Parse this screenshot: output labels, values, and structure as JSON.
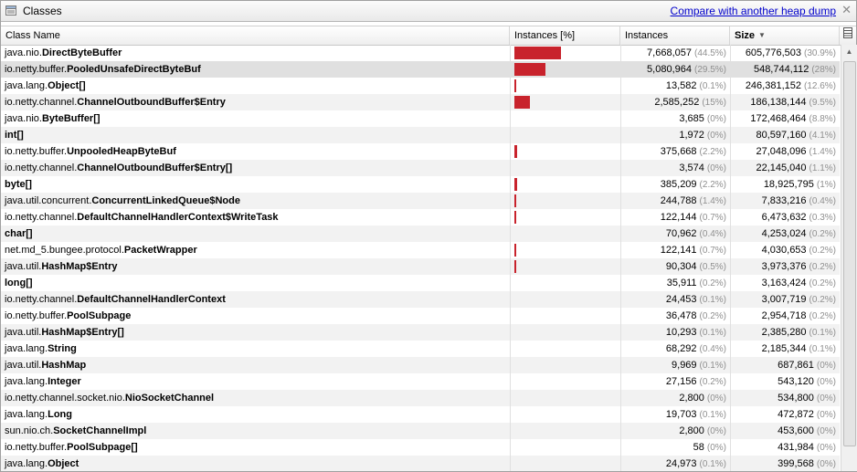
{
  "window": {
    "title": "Classes",
    "compare_link": "Compare with another heap dump",
    "close_glyph": "✕"
  },
  "columns": {
    "name": "Class Name",
    "instances_pct": "Instances [%]",
    "instances": "Instances",
    "size": "Size",
    "sorted_by": "Size"
  },
  "colors": {
    "bar": "#c8232c",
    "link": "#0000cc",
    "percent_text": "#8f8f8f"
  },
  "rows": [
    {
      "prefix": "java.nio.",
      "name": "DirectByteBuffer",
      "instances": "7,668,057",
      "instances_pct": "(44.5%)",
      "size": "605,776,503",
      "size_pct": "(30.9%)",
      "share": 0.445
    },
    {
      "prefix": "io.netty.buffer.",
      "name": "PooledUnsafeDirectByteBuf",
      "instances": "5,080,964",
      "instances_pct": "(29.5%)",
      "size": "548,744,112",
      "size_pct": "(28%)",
      "share": 0.295,
      "selected": true
    },
    {
      "prefix": "java.lang.",
      "name": "Object[]",
      "instances": "13,582",
      "instances_pct": "(0.1%)",
      "size": "246,381,152",
      "size_pct": "(12.6%)",
      "share": 0.001
    },
    {
      "prefix": "io.netty.channel.",
      "name": "ChannelOutboundBuffer$Entry",
      "instances": "2,585,252",
      "instances_pct": "(15%)",
      "size": "186,138,144",
      "size_pct": "(9.5%)",
      "share": 0.15
    },
    {
      "prefix": "java.nio.",
      "name": "ByteBuffer[]",
      "instances": "3,685",
      "instances_pct": "(0%)",
      "size": "172,468,464",
      "size_pct": "(8.8%)",
      "share": 0
    },
    {
      "prefix": "",
      "name": "int[]",
      "instances": "1,972",
      "instances_pct": "(0%)",
      "size": "80,597,160",
      "size_pct": "(4.1%)",
      "share": 0
    },
    {
      "prefix": "io.netty.buffer.",
      "name": "UnpooledHeapByteBuf",
      "instances": "375,668",
      "instances_pct": "(2.2%)",
      "size": "27,048,096",
      "size_pct": "(1.4%)",
      "share": 0.022
    },
    {
      "prefix": "io.netty.channel.",
      "name": "ChannelOutboundBuffer$Entry[]",
      "instances": "3,574",
      "instances_pct": "(0%)",
      "size": "22,145,040",
      "size_pct": "(1.1%)",
      "share": 0
    },
    {
      "prefix": "",
      "name": "byte[]",
      "instances": "385,209",
      "instances_pct": "(2.2%)",
      "size": "18,925,795",
      "size_pct": "(1%)",
      "share": 0.022
    },
    {
      "prefix": "java.util.concurrent.",
      "name": "ConcurrentLinkedQueue$Node",
      "instances": "244,788",
      "instances_pct": "(1.4%)",
      "size": "7,833,216",
      "size_pct": "(0.4%)",
      "share": 0.014
    },
    {
      "prefix": "io.netty.channel.",
      "name": "DefaultChannelHandlerContext$WriteTask",
      "instances": "122,144",
      "instances_pct": "(0.7%)",
      "size": "6,473,632",
      "size_pct": "(0.3%)",
      "share": 0.007
    },
    {
      "prefix": "",
      "name": "char[]",
      "instances": "70,962",
      "instances_pct": "(0.4%)",
      "size": "4,253,024",
      "size_pct": "(0.2%)",
      "share": 0
    },
    {
      "prefix": "net.md_5.bungee.protocol.",
      "name": "PacketWrapper",
      "instances": "122,141",
      "instances_pct": "(0.7%)",
      "size": "4,030,653",
      "size_pct": "(0.2%)",
      "share": 0.007
    },
    {
      "prefix": "java.util.",
      "name": "HashMap$Entry",
      "instances": "90,304",
      "instances_pct": "(0.5%)",
      "size": "3,973,376",
      "size_pct": "(0.2%)",
      "share": 0.005
    },
    {
      "prefix": "",
      "name": "long[]",
      "instances": "35,911",
      "instances_pct": "(0.2%)",
      "size": "3,163,424",
      "size_pct": "(0.2%)",
      "share": 0
    },
    {
      "prefix": "io.netty.channel.",
      "name": "DefaultChannelHandlerContext",
      "instances": "24,453",
      "instances_pct": "(0.1%)",
      "size": "3,007,719",
      "size_pct": "(0.2%)",
      "share": 0
    },
    {
      "prefix": "io.netty.buffer.",
      "name": "PoolSubpage",
      "instances": "36,478",
      "instances_pct": "(0.2%)",
      "size": "2,954,718",
      "size_pct": "(0.2%)",
      "share": 0
    },
    {
      "prefix": "java.util.",
      "name": "HashMap$Entry[]",
      "instances": "10,293",
      "instances_pct": "(0.1%)",
      "size": "2,385,280",
      "size_pct": "(0.1%)",
      "share": 0
    },
    {
      "prefix": "java.lang.",
      "name": "String",
      "instances": "68,292",
      "instances_pct": "(0.4%)",
      "size": "2,185,344",
      "size_pct": "(0.1%)",
      "share": 0
    },
    {
      "prefix": "java.util.",
      "name": "HashMap",
      "instances": "9,969",
      "instances_pct": "(0.1%)",
      "size": "687,861",
      "size_pct": "(0%)",
      "share": 0
    },
    {
      "prefix": "java.lang.",
      "name": "Integer",
      "instances": "27,156",
      "instances_pct": "(0.2%)",
      "size": "543,120",
      "size_pct": "(0%)",
      "share": 0
    },
    {
      "prefix": "io.netty.channel.socket.nio.",
      "name": "NioSocketChannel",
      "instances": "2,800",
      "instances_pct": "(0%)",
      "size": "534,800",
      "size_pct": "(0%)",
      "share": 0
    },
    {
      "prefix": "java.lang.",
      "name": "Long",
      "instances": "19,703",
      "instances_pct": "(0.1%)",
      "size": "472,872",
      "size_pct": "(0%)",
      "share": 0
    },
    {
      "prefix": "sun.nio.ch.",
      "name": "SocketChannelImpl",
      "instances": "2,800",
      "instances_pct": "(0%)",
      "size": "453,600",
      "size_pct": "(0%)",
      "share": 0
    },
    {
      "prefix": "io.netty.buffer.",
      "name": "PoolSubpage[]",
      "instances": "58",
      "instances_pct": "(0%)",
      "size": "431,984",
      "size_pct": "(0%)",
      "share": 0
    },
    {
      "prefix": "java.lang.",
      "name": "Object",
      "instances": "24,973",
      "instances_pct": "(0.1%)",
      "size": "399,568",
      "size_pct": "(0%)",
      "share": 0
    }
  ]
}
